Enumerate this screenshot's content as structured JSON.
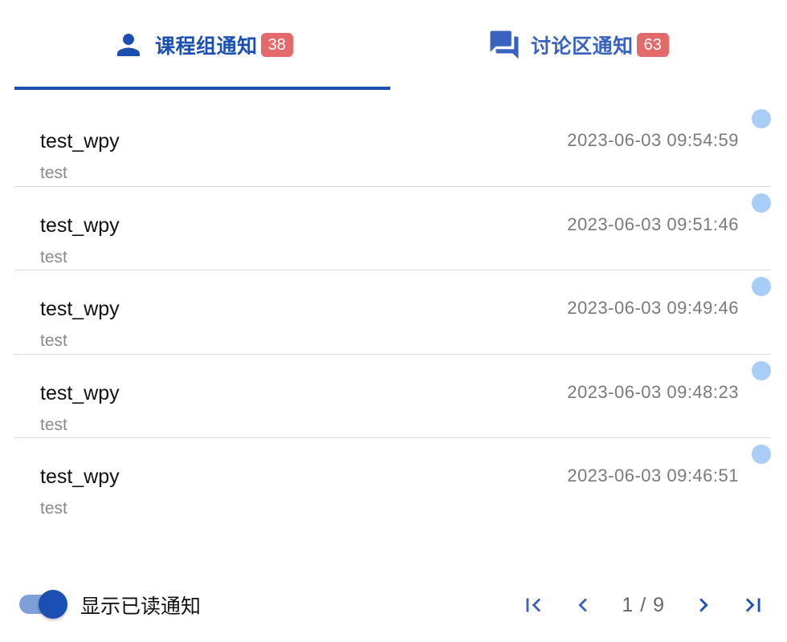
{
  "tabs": [
    {
      "label": "课程组通知",
      "badge": "38",
      "icon": "person-icon",
      "active": true
    },
    {
      "label": "讨论区通知",
      "badge": "63",
      "icon": "forum-icon",
      "active": false
    }
  ],
  "notifications": [
    {
      "title": "test_wpy",
      "subtitle": "test",
      "time": "2023-06-03 09:54:59",
      "unread": true
    },
    {
      "title": "test_wpy",
      "subtitle": "test",
      "time": "2023-06-03 09:51:46",
      "unread": true
    },
    {
      "title": "test_wpy",
      "subtitle": "test",
      "time": "2023-06-03 09:49:46",
      "unread": true
    },
    {
      "title": "test_wpy",
      "subtitle": "test",
      "time": "2023-06-03 09:48:23",
      "unread": true
    },
    {
      "title": "test_wpy",
      "subtitle": "test",
      "time": "2023-06-03 09:46:51",
      "unread": true
    }
  ],
  "footer": {
    "show_read_label": "显示已读通知",
    "show_read_enabled": true,
    "pagination": {
      "current": "1",
      "separator": "/",
      "total": "9",
      "text": "1 / 9"
    }
  },
  "colors": {
    "primary": "#1b4fb1",
    "badge": "#e36a68",
    "unread_dot": "#a8cdf7",
    "divider": "#d9d9d9"
  }
}
